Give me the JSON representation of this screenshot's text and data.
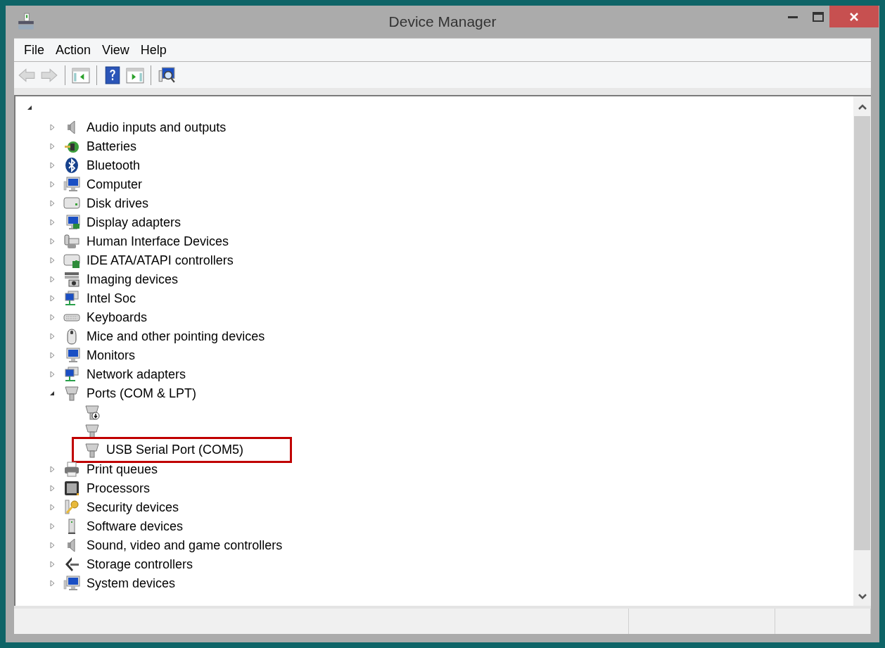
{
  "window": {
    "title": "Device Manager"
  },
  "menu": [
    "File",
    "Action",
    "View",
    "Help"
  ],
  "toolbar": [
    {
      "kind": "back",
      "disabled": true
    },
    {
      "kind": "forward",
      "disabled": true
    },
    {
      "kind": "separator"
    },
    {
      "kind": "console-tree",
      "disabled": false
    },
    {
      "kind": "separator"
    },
    {
      "kind": "help",
      "disabled": false
    },
    {
      "kind": "action-pane",
      "disabled": false
    },
    {
      "kind": "separator"
    },
    {
      "kind": "scan",
      "disabled": false
    }
  ],
  "tree": {
    "expanded": true,
    "children": [
      {
        "label": "Audio inputs and outputs",
        "expanded": false
      },
      {
        "label": "Batteries",
        "expanded": false
      },
      {
        "label": "Bluetooth",
        "expanded": false
      },
      {
        "label": "Computer",
        "expanded": false
      },
      {
        "label": "Disk drives",
        "expanded": false
      },
      {
        "label": "Display adapters",
        "expanded": false
      },
      {
        "label": "Human Interface Devices",
        "expanded": false
      },
      {
        "label": "IDE ATA/ATAPI controllers",
        "expanded": false
      },
      {
        "label": "Imaging devices",
        "expanded": false
      },
      {
        "label": "Intel Soc",
        "expanded": false
      },
      {
        "label": "Keyboards",
        "expanded": false
      },
      {
        "label": "Mice and other pointing devices",
        "expanded": false
      },
      {
        "label": "Monitors",
        "expanded": false
      },
      {
        "label": "Network adapters",
        "expanded": false
      },
      {
        "label": "Ports (COM & LPT)",
        "expanded": true,
        "children": [
          {
            "disabled": true,
            "annotated": false
          },
          {
            "disabled": false,
            "annotated": false
          },
          {
            "label": "USB Serial Port (COM5)",
            "disabled": false,
            "annotated": true
          }
        ]
      },
      {
        "label": "Print queues",
        "expanded": false
      },
      {
        "label": "Processors",
        "expanded": false
      },
      {
        "label": "Security devices",
        "expanded": false
      },
      {
        "label": "Software devices",
        "expanded": false
      },
      {
        "label": "Sound, video and game controllers",
        "expanded": false
      },
      {
        "label": "Storage controllers",
        "expanded": false
      },
      {
        "label": "System devices",
        "expanded": false
      }
    ]
  }
}
